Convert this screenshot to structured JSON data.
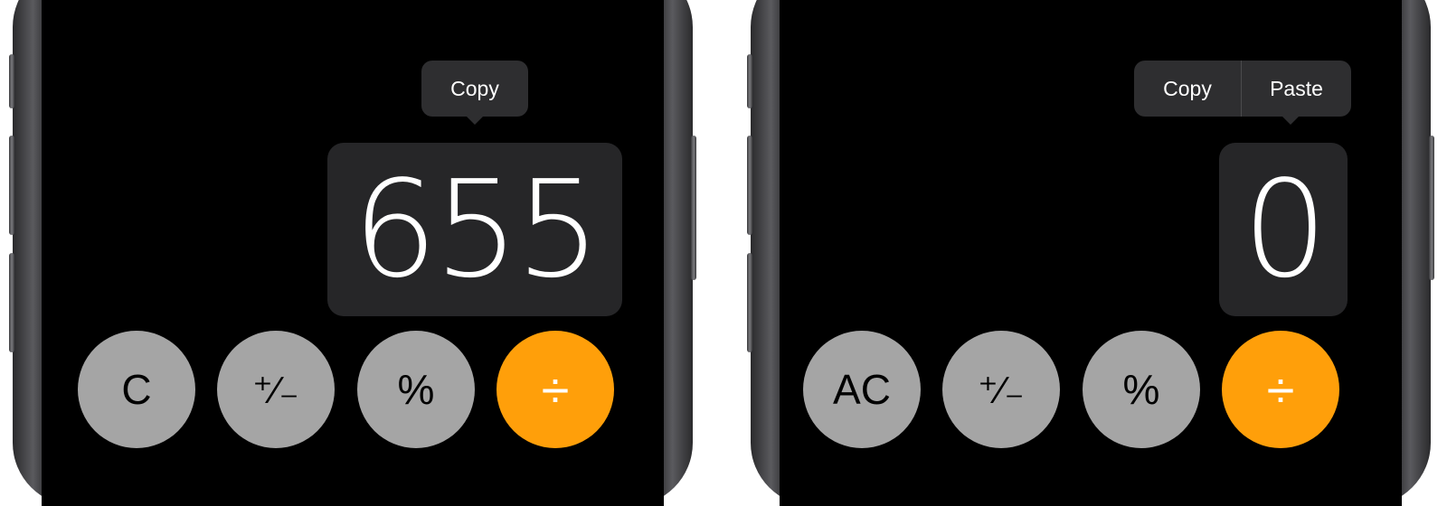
{
  "left": {
    "context_menu": {
      "items": [
        "Copy"
      ]
    },
    "display": {
      "value": "655"
    },
    "keys": [
      {
        "label": "C",
        "type": "function"
      },
      {
        "label": "⁺∕₋",
        "type": "function"
      },
      {
        "label": "%",
        "type": "function"
      },
      {
        "label": "÷",
        "type": "operator"
      }
    ]
  },
  "right": {
    "context_menu": {
      "items": [
        "Copy",
        "Paste"
      ]
    },
    "display": {
      "value": "0"
    },
    "keys": [
      {
        "label": "AC",
        "type": "function"
      },
      {
        "label": "⁺∕₋",
        "type": "function"
      },
      {
        "label": "%",
        "type": "function"
      },
      {
        "label": "÷",
        "type": "operator"
      }
    ]
  },
  "colors": {
    "function_key": "#a5a5a5",
    "operator_key": "#ff9f0a",
    "display_highlight": "#262628",
    "menu_bg": "#2e2e30"
  }
}
